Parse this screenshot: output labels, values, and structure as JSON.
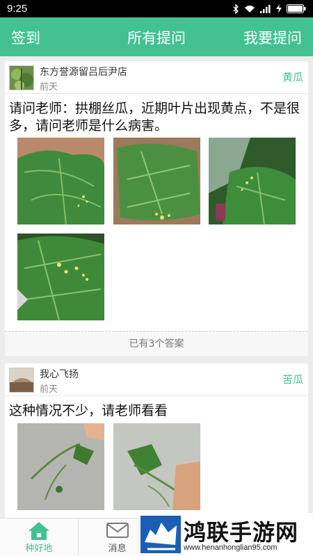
{
  "status_bar": {
    "time": "9:25"
  },
  "header": {
    "left": "签到",
    "title": "所有提问",
    "right": "我要提问"
  },
  "posts": [
    {
      "user": "东方誉源留吕后尹店",
      "time": "前天",
      "tag": "黄瓜",
      "question": "请问老师：拱棚丝瓜，近期叶片出现黄点，不是很多，请问老师是什么病害。",
      "answers": "已有3个答案"
    },
    {
      "user": "我心飞扬",
      "time": "前天",
      "tag": "苦瓜",
      "question": "这种情况不少，请老师看看"
    }
  ],
  "bottom_nav": {
    "home": "种好地",
    "messages": "消息"
  },
  "watermark": {
    "title": "鸿联手游网",
    "url": "www.henanhonglian95.com"
  },
  "colors": {
    "brand": "#43c191",
    "header": "#43c191"
  }
}
